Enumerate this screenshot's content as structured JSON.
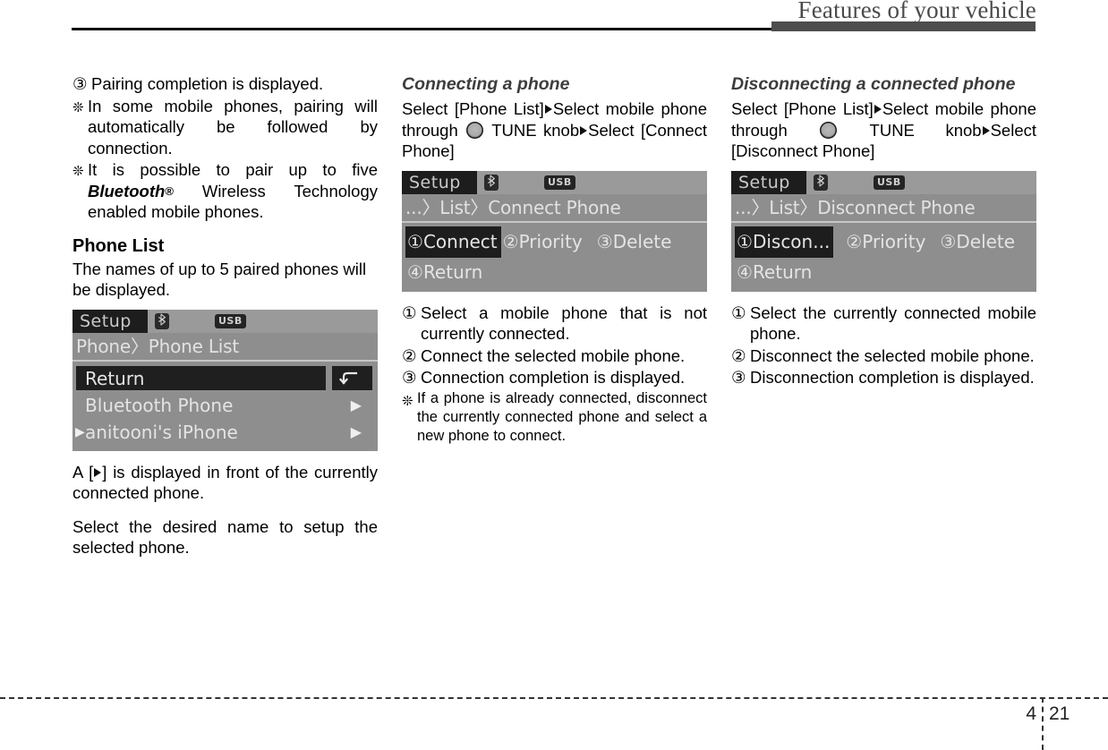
{
  "header": {
    "title": "Features of your vehicle"
  },
  "footer": {
    "chapter": "4",
    "page": "21"
  },
  "col1": {
    "item3": {
      "marker": "③",
      "text": "Pairing completion is displayed."
    },
    "note1": {
      "marker": "❊",
      "text": "In some mobile phones, pairing will automatically be followed by connection."
    },
    "note2": {
      "marker": "❊",
      "text_before": "It is possible to pair up to five ",
      "brand": "Bluetooth",
      "registered": "®",
      "text_after": " Wireless Technology enabled mobile phones."
    },
    "section_title": "Phone List",
    "intro": "The names of up to 5 paired phones will be displayed.",
    "lcd": {
      "tab": "Setup",
      "bluetooth_icon": "bluetooth-icon",
      "usb_badge": "USB",
      "path": "Phone〉Phone List",
      "rows": [
        {
          "label": "Return",
          "selected": true,
          "return_icon": "return-arrow-icon",
          "prefix_arrow": false,
          "trailing_arrow": false
        },
        {
          "label": "Bluetooth Phone",
          "selected": false,
          "prefix_arrow": false,
          "trailing_arrow": true
        },
        {
          "label": "anitooni's iPhone",
          "selected": false,
          "prefix_arrow": true,
          "trailing_arrow": true
        }
      ]
    },
    "after1_before": "A [",
    "after1_after": "] is displayed in front of the currently connected phone.",
    "after2": "Select the desired name to setup the selected phone."
  },
  "col2": {
    "section_title": "Connecting a phone",
    "path_line": {
      "p1": "Select [Phone List]",
      "p2": "Select mobile phone through ",
      "p3": " TUNE knob",
      "p4": "Select [Connect Phone]"
    },
    "lcd": {
      "tab": "Setup",
      "bluetooth_icon": "bluetooth-icon",
      "usb_badge": "USB",
      "path": "...〉List〉Connect Phone",
      "menu_row1": [
        {
          "num": "①",
          "label": "Connect",
          "highlighted": true
        },
        {
          "num": "②",
          "label": "Priority",
          "highlighted": false
        },
        {
          "num": "③",
          "label": "Delete",
          "highlighted": false
        }
      ],
      "menu_row2": [
        {
          "num": "④",
          "label": "Return",
          "highlighted": false
        }
      ]
    },
    "steps": [
      {
        "marker": "①",
        "text": "Select a mobile phone that is not currently connected."
      },
      {
        "marker": "②",
        "text": "Connect the selected mobile phone."
      },
      {
        "marker": "③",
        "text": "Connection completion is displayed."
      }
    ],
    "note": {
      "marker": "❊",
      "text": "If a phone is already connected, disconnect the currently connected phone and select a new phone to connect."
    }
  },
  "col3": {
    "section_title": "Disconnecting a connected phone",
    "path_line": {
      "p1": "Select [Phone List]",
      "p2": "Select mobile phone through ",
      "p3": " TUNE knob",
      "p4": "Select [Disconnect Phone]"
    },
    "lcd": {
      "tab": "Setup",
      "bluetooth_icon": "bluetooth-icon",
      "usb_badge": "USB",
      "path": "...〉List〉Disconnect Phone",
      "menu_row1": [
        {
          "num": "①",
          "label": "Discon...",
          "highlighted": true
        },
        {
          "num": "②",
          "label": "Priority",
          "highlighted": false
        },
        {
          "num": "③",
          "label": "Delete",
          "highlighted": false
        }
      ],
      "menu_row2": [
        {
          "num": "④",
          "label": "Return",
          "highlighted": false
        }
      ]
    },
    "steps": [
      {
        "marker": "①",
        "text": "Select the currently connected mobile phone."
      },
      {
        "marker": "②",
        "text": "Disconnect the selected mobile phone."
      },
      {
        "marker": "③",
        "text": "Disconnection completion is displayed."
      }
    ]
  }
}
